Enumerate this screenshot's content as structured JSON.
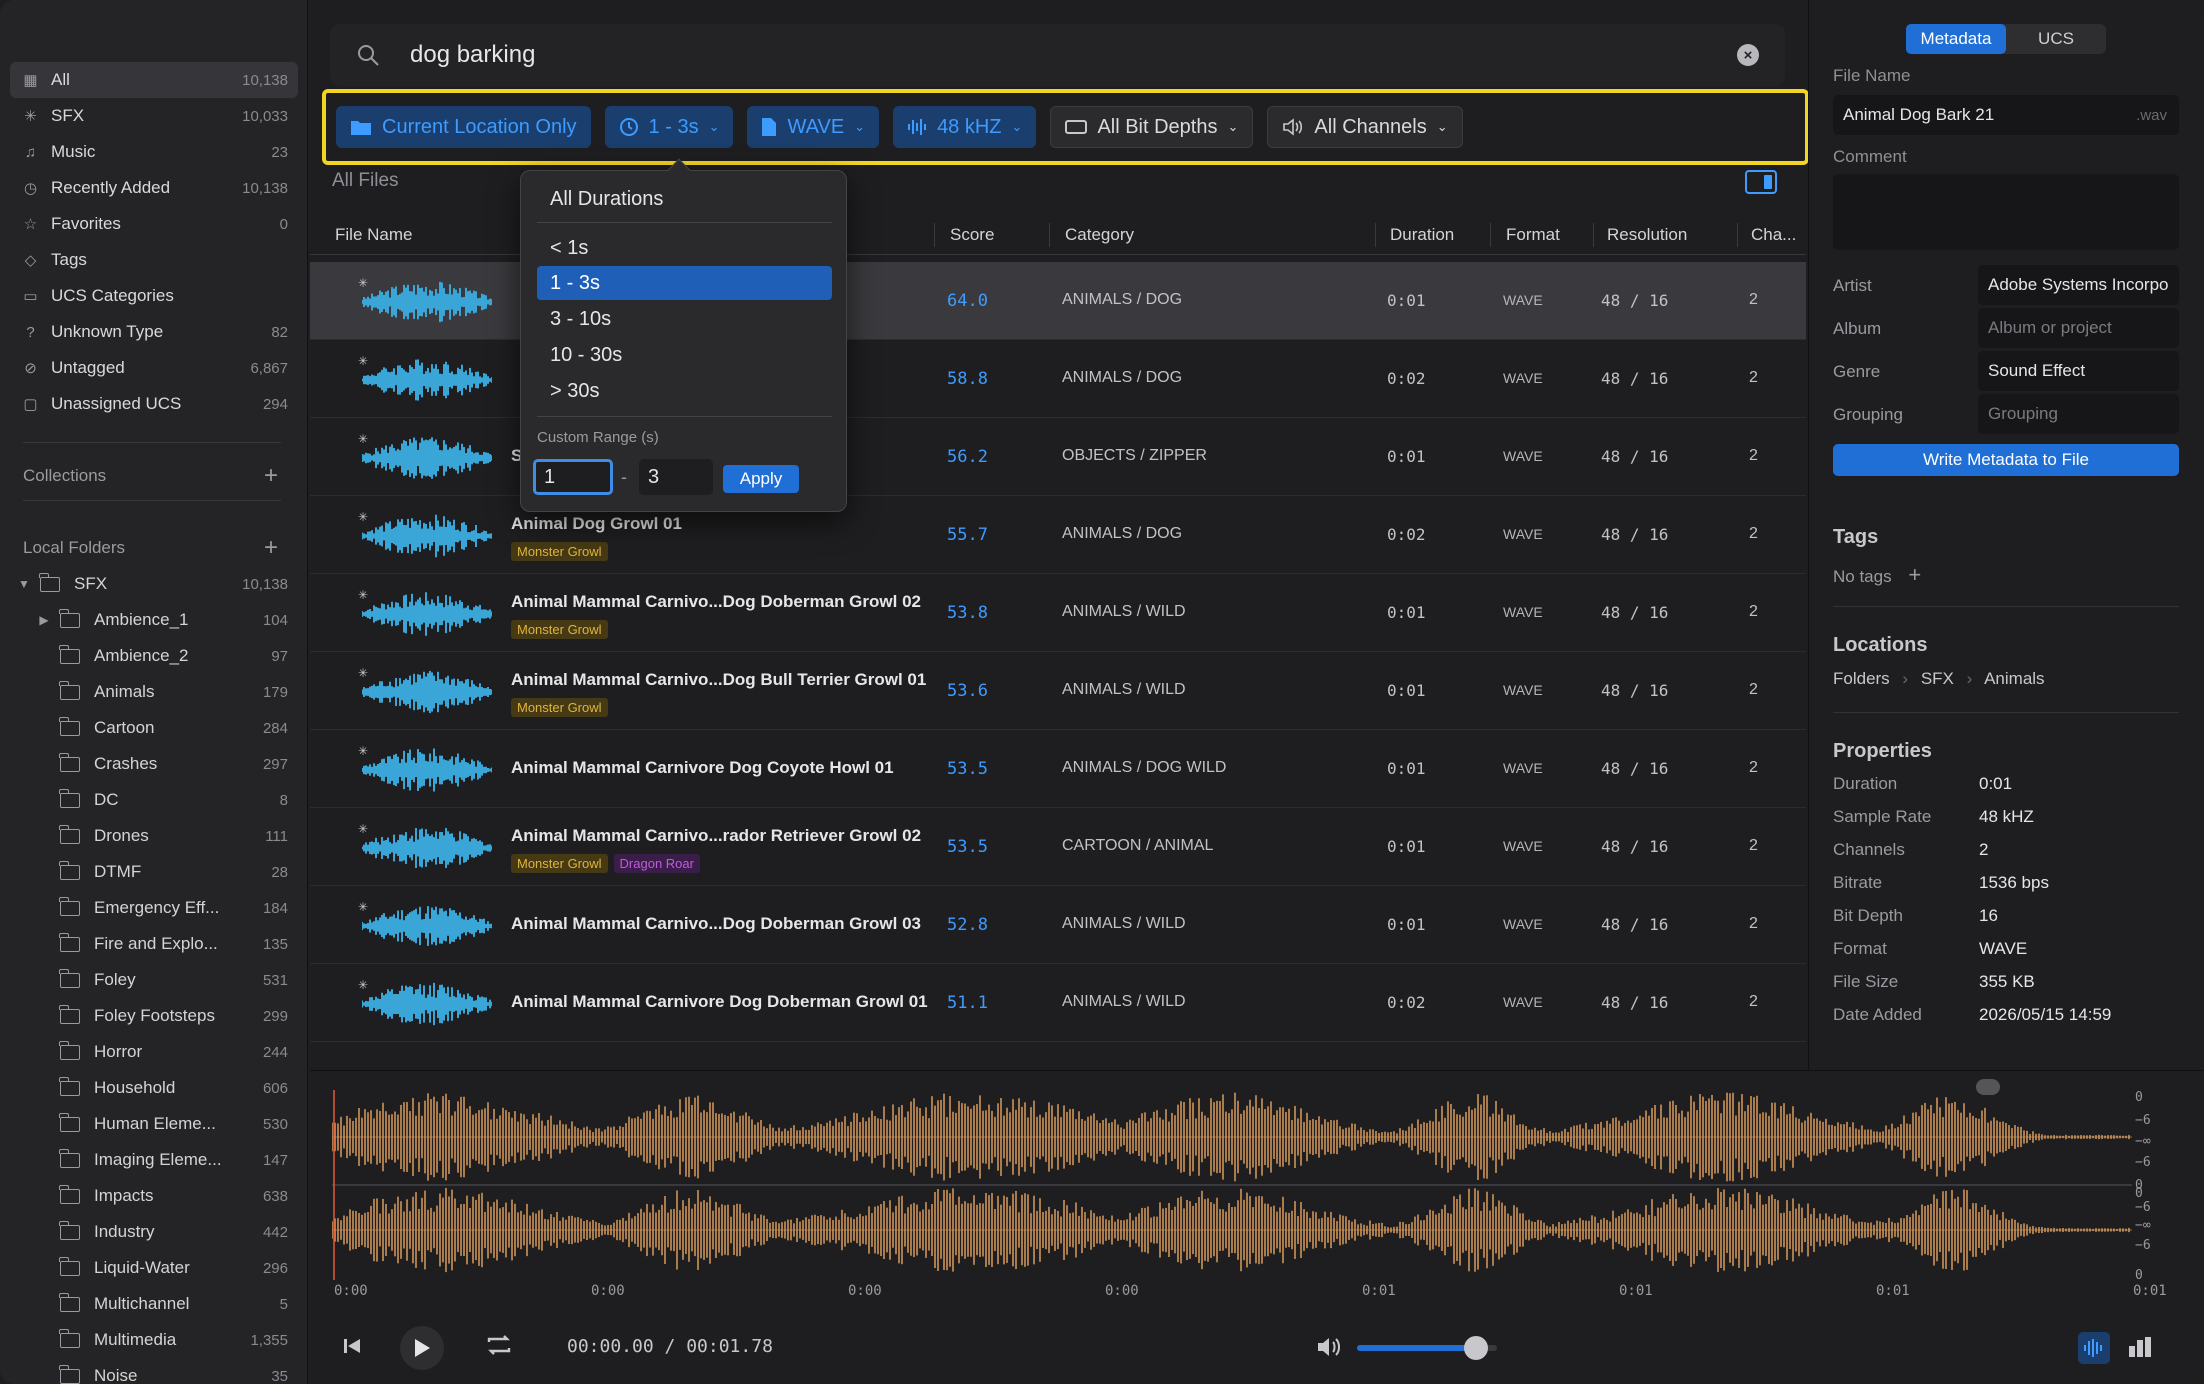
{
  "sidebar": {
    "items": [
      {
        "icon": "grid-icon",
        "label": "All",
        "count": "10,138",
        "active": true
      },
      {
        "icon": "sfx-icon",
        "label": "SFX",
        "count": "10,033"
      },
      {
        "icon": "music-icon",
        "label": "Music",
        "count": "23"
      },
      {
        "icon": "clock-icon",
        "label": "Recently Added",
        "count": "10,138"
      },
      {
        "icon": "star-icon",
        "label": "Favorites",
        "count": "0"
      },
      {
        "icon": "tag-icon",
        "label": "Tags",
        "count": ""
      },
      {
        "icon": "folder-icon",
        "label": "UCS Categories",
        "count": ""
      },
      {
        "icon": "question-icon",
        "label": "Unknown Type",
        "count": "82"
      },
      {
        "icon": "untag-icon",
        "label": "Untagged",
        "count": "6,867"
      },
      {
        "icon": "box-icon",
        "label": "Unassigned UCS",
        "count": "294"
      }
    ],
    "collections_label": "Collections",
    "local_folders_label": "Local Folders",
    "folders": [
      {
        "label": "SFX",
        "count": "10,138",
        "arrow": "▼",
        "level": 0
      },
      {
        "label": "Ambience_1",
        "count": "104",
        "arrow": "▶",
        "level": 1
      },
      {
        "label": "Ambience_2",
        "count": "97",
        "arrow": "",
        "level": 1
      },
      {
        "label": "Animals",
        "count": "179",
        "arrow": "",
        "level": 1
      },
      {
        "label": "Cartoon",
        "count": "284",
        "arrow": "",
        "level": 1
      },
      {
        "label": "Crashes",
        "count": "297",
        "arrow": "",
        "level": 1
      },
      {
        "label": "DC",
        "count": "8",
        "arrow": "",
        "level": 1
      },
      {
        "label": "Drones",
        "count": "111",
        "arrow": "",
        "level": 1
      },
      {
        "label": "DTMF",
        "count": "28",
        "arrow": "",
        "level": 1
      },
      {
        "label": "Emergency Eff...",
        "count": "184",
        "arrow": "",
        "level": 1
      },
      {
        "label": "Fire and Explo...",
        "count": "135",
        "arrow": "",
        "level": 1
      },
      {
        "label": "Foley",
        "count": "531",
        "arrow": "",
        "level": 1
      },
      {
        "label": "Foley Footsteps",
        "count": "299",
        "arrow": "",
        "level": 1
      },
      {
        "label": "Horror",
        "count": "244",
        "arrow": "",
        "level": 1
      },
      {
        "label": "Household",
        "count": "606",
        "arrow": "",
        "level": 1
      },
      {
        "label": "Human Eleme...",
        "count": "530",
        "arrow": "",
        "level": 1
      },
      {
        "label": "Imaging Eleme...",
        "count": "147",
        "arrow": "",
        "level": 1
      },
      {
        "label": "Impacts",
        "count": "638",
        "arrow": "",
        "level": 1
      },
      {
        "label": "Industry",
        "count": "442",
        "arrow": "",
        "level": 1
      },
      {
        "label": "Liquid-Water",
        "count": "296",
        "arrow": "",
        "level": 1
      },
      {
        "label": "Multichannel",
        "count": "5",
        "arrow": "",
        "level": 1
      },
      {
        "label": "Multimedia",
        "count": "1,355",
        "arrow": "",
        "level": 1
      },
      {
        "label": "Noise",
        "count": "35",
        "arrow": "",
        "level": 1
      }
    ]
  },
  "search": {
    "value": "dog barking"
  },
  "filters": {
    "location": "Current Location Only",
    "duration": "1 - 3s",
    "format": "WAVE",
    "sample_rate": "48 kHZ",
    "bit_depth": "All Bit Depths",
    "channels": "All Channels"
  },
  "list": {
    "title": "All Files",
    "headers": {
      "file_name": "File Name",
      "score": "Score",
      "category": "Category",
      "duration": "Duration",
      "format": "Format",
      "resolution": "Resolution",
      "channels": "Cha..."
    },
    "rows": [
      {
        "name": "",
        "tags": [],
        "score": "64.0",
        "category": "ANIMALS / DOG",
        "duration": "0:01",
        "format": "WAVE",
        "resolution": "48 / 16",
        "channels": "2",
        "selected": true
      },
      {
        "name": "",
        "tags": [],
        "score": "58.8",
        "category": "ANIMALS / DOG",
        "duration": "0:02",
        "format": "WAVE",
        "resolution": "48 / 16",
        "channels": "2"
      },
      {
        "name": "S",
        "tags": [],
        "score": "56.2",
        "category": "OBJECTS / ZIPPER",
        "duration": "0:01",
        "format": "WAVE",
        "resolution": "48 / 16",
        "channels": "2"
      },
      {
        "name": "Animal Dog Growl 01",
        "tags": [
          {
            "t": "Monster Growl",
            "c": "y"
          }
        ],
        "score": "55.7",
        "category": "ANIMALS / DOG",
        "duration": "0:02",
        "format": "WAVE",
        "resolution": "48 / 16",
        "channels": "2"
      },
      {
        "name": "Animal Mammal Carnivo...Dog Doberman Growl 02",
        "tags": [
          {
            "t": "Monster Growl",
            "c": "y"
          }
        ],
        "score": "53.8",
        "category": "ANIMALS / WILD",
        "duration": "0:01",
        "format": "WAVE",
        "resolution": "48 / 16",
        "channels": "2"
      },
      {
        "name": "Animal Mammal Carnivo...Dog Bull Terrier Growl 01",
        "tags": [
          {
            "t": "Monster Growl",
            "c": "y"
          }
        ],
        "score": "53.6",
        "category": "ANIMALS / WILD",
        "duration": "0:01",
        "format": "WAVE",
        "resolution": "48 / 16",
        "channels": "2"
      },
      {
        "name": "Animal Mammal Carnivore Dog Coyote Howl 01",
        "tags": [],
        "score": "53.5",
        "category": "ANIMALS / DOG WILD",
        "duration": "0:01",
        "format": "WAVE",
        "resolution": "48 / 16",
        "channels": "2"
      },
      {
        "name": "Animal Mammal Carnivo...rador Retriever Growl 02",
        "tags": [
          {
            "t": "Monster Growl",
            "c": "y"
          },
          {
            "t": "Dragon Roar",
            "c": "p"
          }
        ],
        "score": "53.5",
        "category": "CARTOON / ANIMAL",
        "duration": "0:01",
        "format": "WAVE",
        "resolution": "48 / 16",
        "channels": "2"
      },
      {
        "name": "Animal Mammal Carnivo...Dog Doberman Growl 03",
        "tags": [],
        "score": "52.8",
        "category": "ANIMALS / WILD",
        "duration": "0:01",
        "format": "WAVE",
        "resolution": "48 / 16",
        "channels": "2"
      },
      {
        "name": "Animal Mammal Carnivore Dog Doberman Growl 01",
        "tags": [],
        "score": "51.1",
        "category": "ANIMALS / WILD",
        "duration": "0:02",
        "format": "WAVE",
        "resolution": "48 / 16",
        "channels": "2"
      }
    ]
  },
  "dropdown": {
    "items": [
      "All Durations",
      "< 1s",
      "1 - 3s",
      "3 - 10s",
      "10 - 30s",
      "> 30s"
    ],
    "selected": "1 - 3s",
    "custom_label": "Custom Range (s)",
    "from": "1",
    "to": "3",
    "apply": "Apply"
  },
  "panel": {
    "tabs": [
      "Metadata",
      "UCS"
    ],
    "file_name_label": "File Name",
    "file_name": "Animal Dog Bark 21",
    "file_ext": ".wav",
    "comment_label": "Comment",
    "fields": [
      {
        "k": "Artist",
        "v": "Adobe Systems Incorpo",
        "ph": false
      },
      {
        "k": "Album",
        "v": "Album or project",
        "ph": true
      },
      {
        "k": "Genre",
        "v": "Sound Effect",
        "ph": false
      },
      {
        "k": "Grouping",
        "v": "Grouping",
        "ph": true
      }
    ],
    "write_button": "Write Metadata to File",
    "tags_title": "Tags",
    "no_tags": "No tags",
    "locations_title": "Locations",
    "locations": [
      "Folders",
      "SFX",
      "Animals"
    ],
    "properties_title": "Properties",
    "properties": [
      {
        "k": "Duration",
        "v": "0:01"
      },
      {
        "k": "Sample Rate",
        "v": "48 kHZ"
      },
      {
        "k": "Channels",
        "v": "2"
      },
      {
        "k": "Bitrate",
        "v": "1536 bps"
      },
      {
        "k": "Bit Depth",
        "v": "16"
      },
      {
        "k": "Format",
        "v": "WAVE"
      },
      {
        "k": "File Size",
        "v": "355 KB"
      },
      {
        "k": "Date Added",
        "v": "2026/05/15 14:59"
      }
    ]
  },
  "player": {
    "time": "00:00.00 / 00:01.78",
    "timeline": [
      "0:00",
      "0:00",
      "0:00",
      "0:00",
      "0:01",
      "0:01",
      "0:01",
      "0:01"
    ],
    "db_labels": [
      "0",
      "−6",
      "−∞",
      "−6",
      "0",
      "0",
      "−6",
      "−∞",
      "−6",
      "0"
    ],
    "volume": 0.85,
    "wave_color": "#d99b5a"
  },
  "colors": {
    "accent": "#1f6fd6",
    "highlight": "#f2d422",
    "score": "#3e9bff"
  }
}
